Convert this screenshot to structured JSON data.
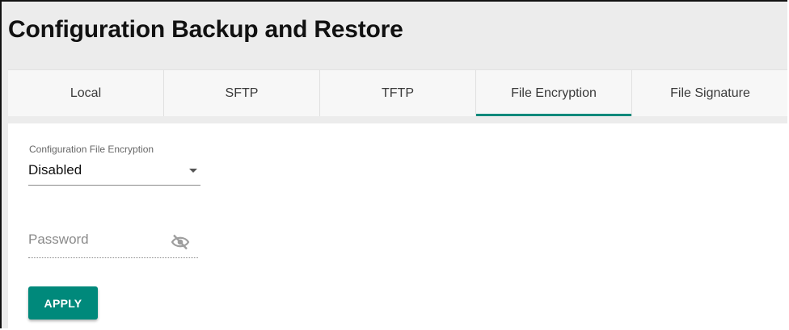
{
  "page": {
    "title": "Configuration Backup and Restore"
  },
  "tabs": [
    {
      "label": "Local"
    },
    {
      "label": "SFTP"
    },
    {
      "label": "TFTP"
    },
    {
      "label": "File Encryption",
      "active": true
    },
    {
      "label": "File Signature"
    }
  ],
  "form": {
    "encryption": {
      "label": "Configuration File Encryption",
      "value": "Disabled"
    },
    "password": {
      "placeholder": "Password",
      "value": "",
      "icon": "visibility-off-icon"
    },
    "apply_label": "APPLY"
  },
  "colors": {
    "accent": "#00897b"
  }
}
